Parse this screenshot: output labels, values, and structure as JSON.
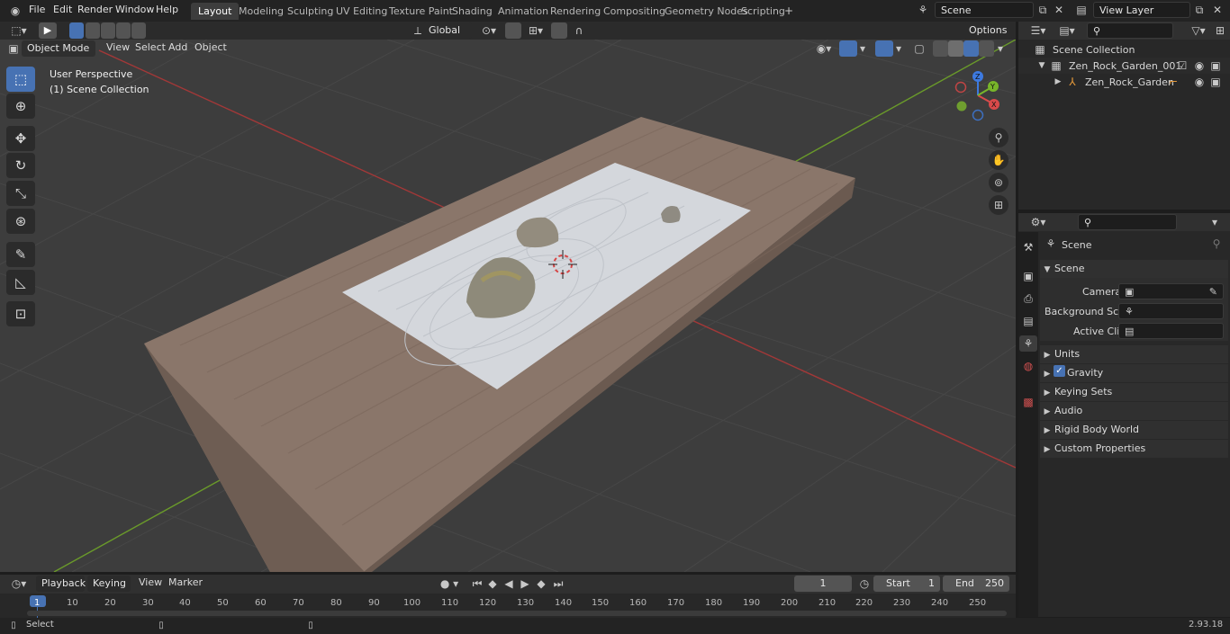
{
  "menu": [
    "File",
    "Edit",
    "Render",
    "Window",
    "Help"
  ],
  "workspaces": [
    "Layout",
    "Modeling",
    "Sculpting",
    "UV Editing",
    "Texture Paint",
    "Shading",
    "Animation",
    "Rendering",
    "Compositing",
    "Geometry Nodes",
    "Scripting"
  ],
  "active_workspace": "Layout",
  "scene_field": "Scene",
  "view_layer_field": "View Layer",
  "viewport": {
    "mode": "Object Mode",
    "header_menus": [
      "View",
      "Select",
      "Add",
      "Object"
    ],
    "transform_orientation": "Global",
    "options_label": "Options",
    "overlay_title": "User Perspective",
    "overlay_collection": "(1) Scene Collection",
    "gizmo_axes": {
      "x": "X",
      "y": "Y",
      "z": "Z"
    }
  },
  "outliner": {
    "root": "Scene Collection",
    "items": [
      {
        "name": "Zen_Rock_Garden_001"
      },
      {
        "name": "Zen_Rock_Garden"
      }
    ]
  },
  "properties": {
    "context": "Scene",
    "panel": "Scene",
    "camera_label": "Camera",
    "background_scene_label": "Background Scene",
    "active_clip_label": "Active Clip",
    "subpanels": [
      "Units",
      "Gravity",
      "Keying Sets",
      "Audio",
      "Rigid Body World",
      "Custom Properties"
    ],
    "gravity_checked": true
  },
  "timeline": {
    "menus": [
      "Playback",
      "Keying",
      "View",
      "Marker"
    ],
    "current_frame": "1",
    "start_label": "Start",
    "start_value": "1",
    "end_label": "End",
    "end_value": "250",
    "ticks": [
      "1",
      "10",
      "20",
      "30",
      "40",
      "50",
      "60",
      "70",
      "80",
      "90",
      "100",
      "110",
      "120",
      "130",
      "140",
      "150",
      "160",
      "170",
      "180",
      "190",
      "200",
      "210",
      "220",
      "230",
      "240",
      "250"
    ]
  },
  "status": {
    "left": "Select",
    "version": "2.93.18"
  },
  "colors": {
    "accent": "#4772b3",
    "wood": "#8a766a",
    "sand": "#d4d7dc",
    "x_axis": "#c23b3b",
    "y_axis": "#6d9a2b"
  }
}
